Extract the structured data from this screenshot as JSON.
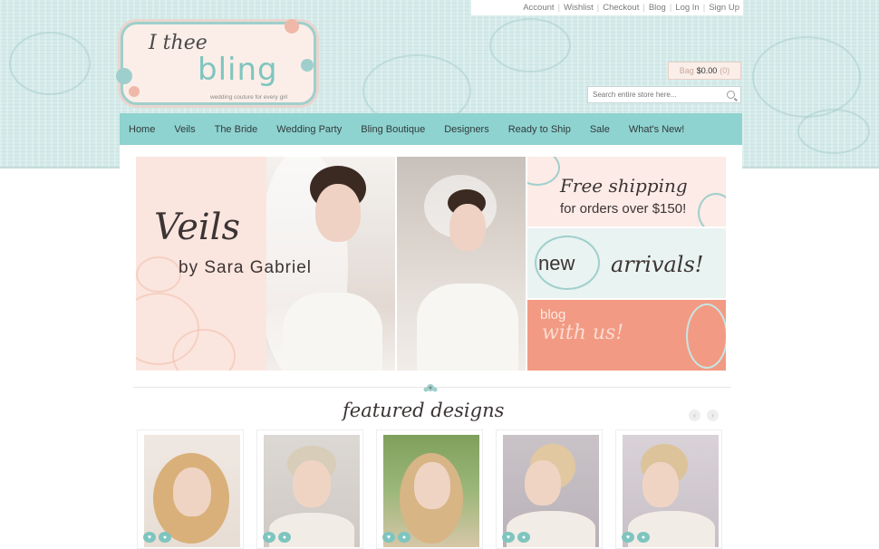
{
  "top_links": [
    "Account",
    "Wishlist",
    "Checkout",
    "Blog",
    "Log In",
    "Sign Up"
  ],
  "logo": {
    "script": "I thee",
    "wordmark": "bling",
    "tagline": "wedding couture for every girl"
  },
  "cart": {
    "label": "Bag",
    "amount": "$0.00",
    "count": "(0)"
  },
  "search": {
    "placeholder": "Search entire store here..."
  },
  "nav": [
    "Home",
    "Veils",
    "The Bride",
    "Wedding Party",
    "Bling Boutique",
    "Designers",
    "Ready to Ship",
    "Sale",
    "What's New!"
  ],
  "hero": {
    "title": "Veils",
    "subtitle": "by Sara Gabriel"
  },
  "promos": [
    {
      "line1": "Free shipping",
      "line2": "for orders over $150!"
    },
    {
      "line1": "new",
      "line2": "arrivals!"
    },
    {
      "line1": "blog",
      "line2": "with us!"
    }
  ],
  "featured": {
    "title": "featured designs",
    "prev": "‹",
    "next": "›"
  },
  "colors": {
    "accent": "#8fd3d0",
    "header_bg": "#d5ebea",
    "blush": "#fbe6df",
    "coral": "#f29a83"
  },
  "product_card_buttons": {
    "wishlist": "♥",
    "view": "●"
  }
}
